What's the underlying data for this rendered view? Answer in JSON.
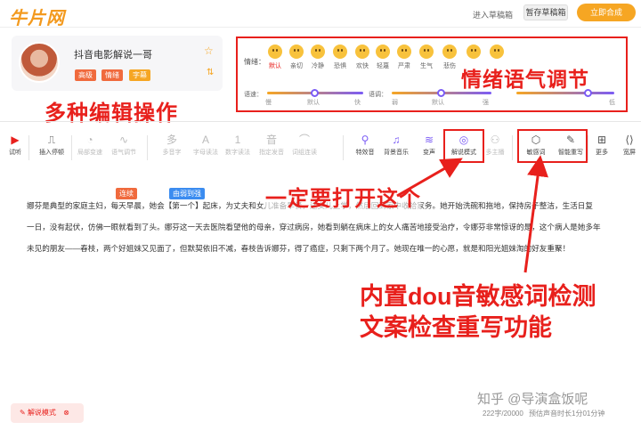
{
  "header": {
    "logo": "牛片网",
    "enter_draft": "进入草稿箱",
    "save_draft": "暂存草稿箱",
    "synthesize": "立即合成"
  },
  "profile": {
    "name": "抖音电影解说一哥",
    "tags": [
      {
        "label": "高级",
        "color": "#f06a3d"
      },
      {
        "label": "情绪",
        "color": "#f06a3d"
      },
      {
        "label": "字幕",
        "color": "#f6a623"
      }
    ],
    "star_icon": "star-icon",
    "sort_icon": "sort-icon"
  },
  "emotion": {
    "label": "情绪：",
    "items": [
      "默认",
      "亲切",
      "冷静",
      "恐惧",
      "欢快",
      "轻蔑",
      "严肃",
      "生气",
      "悲伤",
      "",
      ""
    ],
    "selected": 0
  },
  "sliders": {
    "speed": {
      "label": "语速：",
      "ticks": [
        "慢",
        "默认",
        "快"
      ],
      "value": 0.5
    },
    "intonation": {
      "label": "语调：",
      "ticks": [
        "弱",
        "默认",
        "强"
      ],
      "value": 0.5
    },
    "third": {
      "label": "",
      "ticks": [
        "",
        "",
        "低"
      ],
      "value": 0.78
    }
  },
  "annotations": {
    "emotion_tone": "情绪语气调节",
    "multi_edit": "多种编辑操作",
    "must_open": "一定要打开这个",
    "sensitive_1": "内置dou音敏感词检测",
    "sensitive_2": "文案检查重写功能"
  },
  "toolbar": [
    {
      "label": "试听",
      "icon": "play-icon",
      "disabled": false
    },
    {
      "label": "插入停顿",
      "icon": "pause-insert-icon",
      "disabled": false
    },
    {
      "label": "局部变速",
      "icon": "speed-icon",
      "disabled": true
    },
    {
      "label": "语气调节",
      "icon": "tone-icon",
      "disabled": true
    },
    {
      "label": "多音字",
      "icon": "polyphone-icon",
      "disabled": true
    },
    {
      "label": "字母读法",
      "icon": "letter-icon",
      "disabled": true
    },
    {
      "label": "数字读法",
      "icon": "number-icon",
      "disabled": true
    },
    {
      "label": "指定发音",
      "icon": "pronounce-icon",
      "disabled": true
    },
    {
      "label": "词组连读",
      "icon": "phrase-icon",
      "disabled": true
    },
    {
      "label": "特效音",
      "icon": "sfx-icon",
      "disabled": false
    },
    {
      "label": "背景音乐",
      "icon": "music-icon",
      "disabled": false
    },
    {
      "label": "变声",
      "icon": "voice-change-icon",
      "disabled": false
    },
    {
      "label": "解说模式",
      "icon": "narration-icon",
      "disabled": false
    },
    {
      "label": "多主播",
      "icon": "multi-host-icon",
      "disabled": true
    },
    {
      "label": "敏感词",
      "icon": "sensitive-icon",
      "disabled": false
    },
    {
      "label": "智能重写",
      "icon": "rewrite-icon",
      "disabled": false
    },
    {
      "label": "更多",
      "icon": "more-icon",
      "disabled": false
    },
    {
      "label": "宽屏",
      "icon": "widescreen-icon",
      "disabled": false
    }
  ],
  "chips": {
    "c1": "连续",
    "c2": "由弱到强"
  },
  "paragraphs": [
    "娜芬是典型的家庭主妇，每天早晨，她会【第一个】起床，为丈夫和女儿准备早餐，送女儿上学，然后回到家中收拾家务。她开始洗碗和拖地，保持房子整洁，生活日复",
    "一日，没有起伏，仿佛一眼就看到了头。娜芬这一天去医院看望他的母亲，穿过病房，她看到躺在病床上的女人痛苦地接受治疗，令娜芬非常惊讶的是，这个病人是她多年",
    "未见的朋友——春枝，两个好姐妹又见面了，但默契依旧不减，春枝告诉娜芬，得了癌症，只剩下两个月了。她现在唯一的心愿，就是和阳光姐妹淘的好友重聚！"
  ],
  "footer": {
    "mode_pill": "解说模式",
    "watermark": "知乎 @导演盒饭呢",
    "count": "222字/20000",
    "estimate": "预估声音时长1分01分钟"
  }
}
